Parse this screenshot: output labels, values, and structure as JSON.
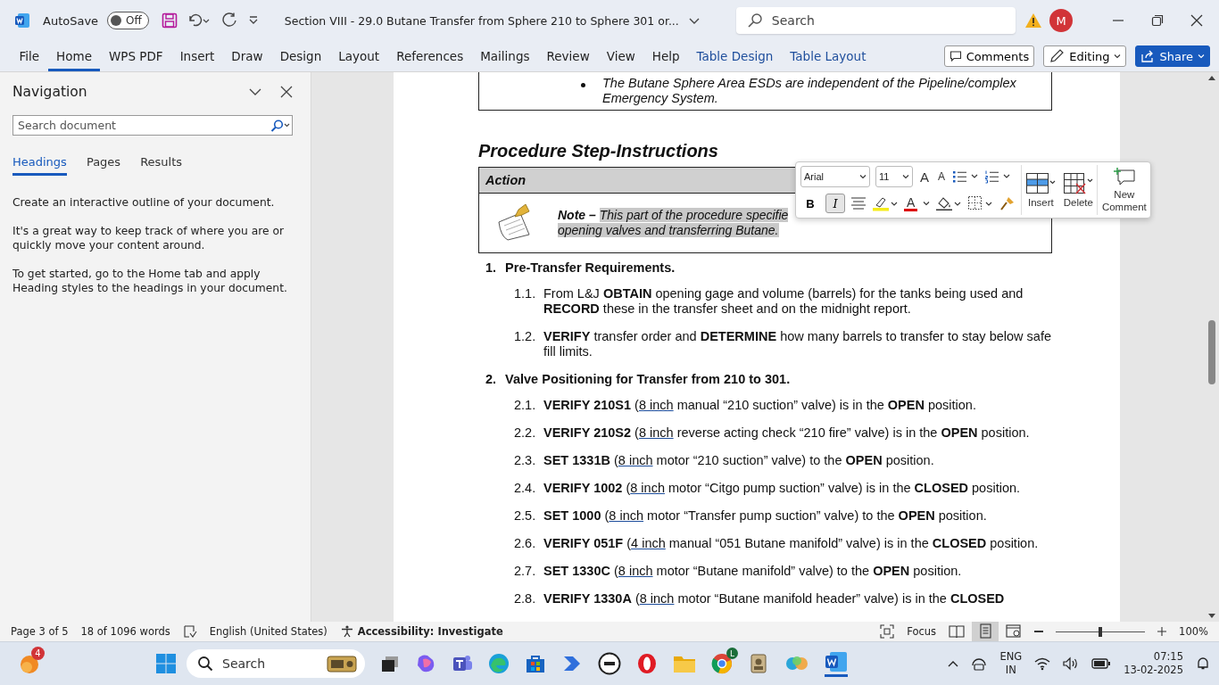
{
  "titlebar": {
    "autosave_label": "AutoSave",
    "autosave": {
      "on": false,
      "label": "Off"
    },
    "document_title": "Section VIII - 29.0 Butane Transfer from Sphere 210 to Sphere 301 or...",
    "search_placeholder": "Search",
    "avatar": "M"
  },
  "ribbon": {
    "tabs": [
      {
        "label": "File",
        "selected": false,
        "kind": "normal"
      },
      {
        "label": "Home",
        "selected": true,
        "kind": "normal"
      },
      {
        "label": "WPS PDF",
        "selected": false,
        "kind": "normal"
      },
      {
        "label": "Insert",
        "selected": false,
        "kind": "normal"
      },
      {
        "label": "Draw",
        "selected": false,
        "kind": "normal"
      },
      {
        "label": "Design",
        "selected": false,
        "kind": "normal"
      },
      {
        "label": "Layout",
        "selected": false,
        "kind": "normal"
      },
      {
        "label": "References",
        "selected": false,
        "kind": "normal"
      },
      {
        "label": "Mailings",
        "selected": false,
        "kind": "normal"
      },
      {
        "label": "Review",
        "selected": false,
        "kind": "normal"
      },
      {
        "label": "View",
        "selected": false,
        "kind": "normal"
      },
      {
        "label": "Help",
        "selected": false,
        "kind": "normal"
      },
      {
        "label": "Table Design",
        "selected": false,
        "kind": "contextual"
      },
      {
        "label": "Table Layout",
        "selected": false,
        "kind": "contextual"
      }
    ],
    "comments": "Comments",
    "editing": "Editing",
    "share": "Share"
  },
  "navigation": {
    "title": "Navigation",
    "search_placeholder": "Search document",
    "tabs": [
      {
        "label": "Headings",
        "selected": true
      },
      {
        "label": "Pages",
        "selected": false
      },
      {
        "label": "Results",
        "selected": false
      }
    ],
    "paragraphs": [
      "Create an interactive outline of your document.",
      "It's a great way to keep track of where you are or quickly move your content around.",
      "To get started, go to the Home tab and apply Heading styles to the headings in your document."
    ]
  },
  "document": {
    "bullet_box": "The Butane Sphere Area ESDs are independent of the Pipeline/complex Emergency System.",
    "heading": "Procedure Step-Instructions",
    "table_header": "Action",
    "note": {
      "label": "Note –",
      "lines": [
        "This part of the procedure specifie",
        "opening valves and transferring Butane."
      ]
    },
    "sections": [
      {
        "number": "1.",
        "title": "Pre-Transfer Requirements.",
        "items": [
          {
            "number": "1.1.",
            "parts": [
              {
                "kind": "plain",
                "text": "From L&J "
              },
              {
                "kind": "bold",
                "text": "OBTAIN"
              },
              {
                "kind": "plain",
                "text": " opening gage and volume (barrels) for the tanks being used and "
              },
              {
                "kind": "bold",
                "text": "RECORD"
              },
              {
                "kind": "plain",
                "text": " these in the transfer sheet and on the midnight report."
              }
            ]
          },
          {
            "number": "1.2.",
            "parts": [
              {
                "kind": "bold",
                "text": "VERIFY"
              },
              {
                "kind": "plain",
                "text": " transfer order and "
              },
              {
                "kind": "bold",
                "text": "DETERMINE"
              },
              {
                "kind": "plain",
                "text": " how many barrels to transfer to stay below safe fill limits."
              }
            ]
          }
        ]
      },
      {
        "number": "2.",
        "title": "Valve Positioning for Transfer from 210 to 301.",
        "items": [
          {
            "number": "2.1.",
            "parts": [
              {
                "kind": "bold",
                "text": "VERIFY 210S1"
              },
              {
                "kind": "plain",
                "text": " ("
              },
              {
                "kind": "underline",
                "text": "8 inch"
              },
              {
                "kind": "plain",
                "text": " manual “210 suction” valve) is in the "
              },
              {
                "kind": "bold",
                "text": "OPEN"
              },
              {
                "kind": "plain",
                "text": " position."
              }
            ]
          },
          {
            "number": "2.2.",
            "parts": [
              {
                "kind": "bold",
                "text": "VERIFY 210S2"
              },
              {
                "kind": "plain",
                "text": " ("
              },
              {
                "kind": "underline",
                "text": "8 inch"
              },
              {
                "kind": "plain",
                "text": " reverse acting check “210 fire” valve) is in the "
              },
              {
                "kind": "bold",
                "text": "OPEN"
              },
              {
                "kind": "plain",
                "text": " position."
              }
            ]
          },
          {
            "number": "2.3.",
            "parts": [
              {
                "kind": "bold",
                "text": "SET 1331B"
              },
              {
                "kind": "plain",
                "text": " ("
              },
              {
                "kind": "underline",
                "text": "8 inch"
              },
              {
                "kind": "plain",
                "text": " motor “210 suction” valve) to the "
              },
              {
                "kind": "bold",
                "text": "OPEN"
              },
              {
                "kind": "plain",
                "text": " position."
              }
            ]
          },
          {
            "number": "2.4.",
            "parts": [
              {
                "kind": "bold",
                "text": "VERIFY 1002"
              },
              {
                "kind": "plain",
                "text": " ("
              },
              {
                "kind": "underline",
                "text": "8 inch"
              },
              {
                "kind": "plain",
                "text": " motor “Citgo pump suction” valve) is in the "
              },
              {
                "kind": "bold",
                "text": "CLOSED"
              },
              {
                "kind": "plain",
                "text": " position."
              }
            ]
          },
          {
            "number": "2.5.",
            "parts": [
              {
                "kind": "bold",
                "text": "SET 1000"
              },
              {
                "kind": "plain",
                "text": " ("
              },
              {
                "kind": "underline",
                "text": "8 inch"
              },
              {
                "kind": "plain",
                "text": " motor “Transfer pump suction” valve) to the "
              },
              {
                "kind": "bold",
                "text": "OPEN"
              },
              {
                "kind": "plain",
                "text": " position."
              }
            ]
          },
          {
            "number": "2.6.",
            "parts": [
              {
                "kind": "bold",
                "text": "VERIFY 051F"
              },
              {
                "kind": "plain",
                "text": " ("
              },
              {
                "kind": "underline",
                "text": "4 inch"
              },
              {
                "kind": "plain",
                "text": " manual “051 Butane manifold” valve) is in the "
              },
              {
                "kind": "bold",
                "text": "CLOSED"
              },
              {
                "kind": "plain",
                "text": " position."
              }
            ]
          },
          {
            "number": "2.7.",
            "parts": [
              {
                "kind": "bold",
                "text": "SET 1330C"
              },
              {
                "kind": "plain",
                "text": " ("
              },
              {
                "kind": "underline",
                "text": "8 inch"
              },
              {
                "kind": "plain",
                "text": " motor “Butane manifold” valve) to the "
              },
              {
                "kind": "bold",
                "text": "OPEN"
              },
              {
                "kind": "plain",
                "text": " position."
              }
            ]
          },
          {
            "number": "2.8.",
            "parts": [
              {
                "kind": "bold",
                "text": "VERIFY 1330A"
              },
              {
                "kind": "plain",
                "text": " ("
              },
              {
                "kind": "underline",
                "text": "8 inch"
              },
              {
                "kind": "plain",
                "text": " motor “Butane manifold header” valve) is in the "
              },
              {
                "kind": "bold",
                "text": "CLOSED"
              }
            ]
          }
        ]
      }
    ]
  },
  "mini_toolbar": {
    "font": "Arial",
    "size": "11",
    "grow_glyph": "A",
    "shrink_glyph": "A",
    "bold": {
      "glyph": "B",
      "selected": false
    },
    "italic": {
      "glyph": "I",
      "selected": true
    },
    "font_color_glyph": "A",
    "insert": "Insert",
    "delete": "Delete",
    "new_comment": "New Comment"
  },
  "status_bar": {
    "page": "Page 3 of 5",
    "words": "18 of 1096 words",
    "language": "English (United States)",
    "accessibility": "Accessibility: Investigate",
    "focus": "Focus",
    "zoom": {
      "level": 0.5
    },
    "zoom_reading": "100%"
  },
  "taskbar": {
    "weather_badge": "4",
    "search_placeholder": "Search",
    "chrome_badge": "L",
    "lang": "ENG",
    "region": "IN",
    "time": "07:15",
    "date": "13-02-2025"
  }
}
